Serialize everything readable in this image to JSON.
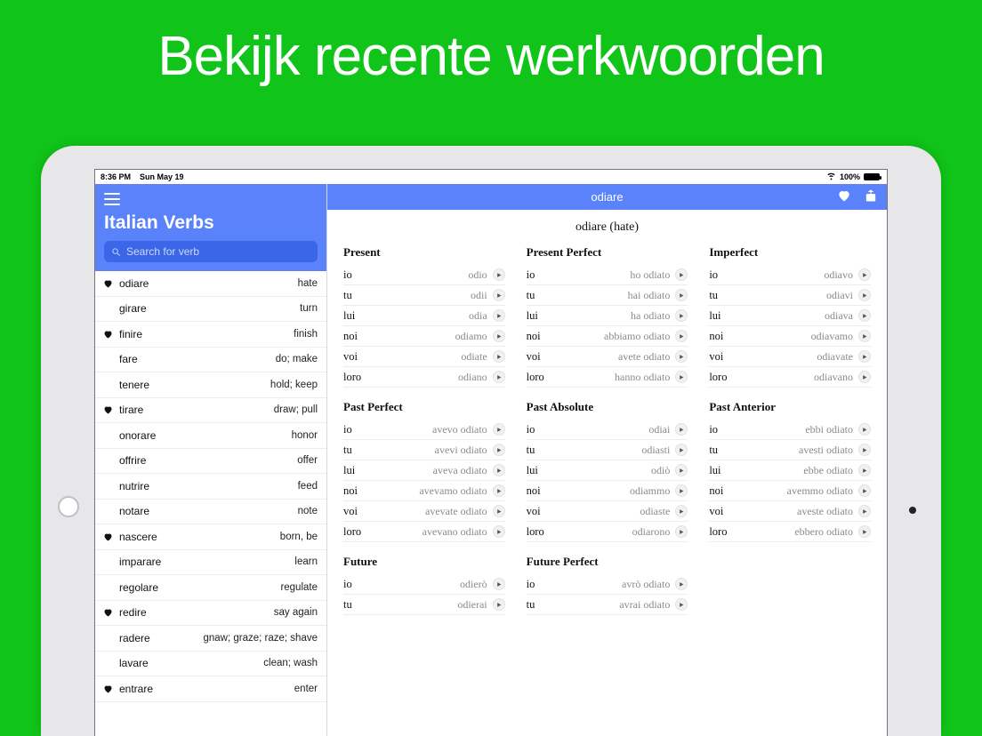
{
  "hero": "Bekijk recente werkwoorden",
  "status": {
    "time": "8:36 PM",
    "date": "Sun May 19",
    "battery": "100%"
  },
  "sidebar": {
    "title": "Italian Verbs",
    "search_placeholder": "Search for verb",
    "items": [
      {
        "fav": true,
        "verb": "odiare",
        "trans": "hate"
      },
      {
        "fav": false,
        "verb": "girare",
        "trans": "turn"
      },
      {
        "fav": true,
        "verb": "finire",
        "trans": "finish"
      },
      {
        "fav": false,
        "verb": "fare",
        "trans": "do; make"
      },
      {
        "fav": false,
        "verb": "tenere",
        "trans": "hold; keep"
      },
      {
        "fav": true,
        "verb": "tirare",
        "trans": "draw; pull"
      },
      {
        "fav": false,
        "verb": "onorare",
        "trans": "honor"
      },
      {
        "fav": false,
        "verb": "offrire",
        "trans": "offer"
      },
      {
        "fav": false,
        "verb": "nutrire",
        "trans": "feed"
      },
      {
        "fav": false,
        "verb": "notare",
        "trans": "note"
      },
      {
        "fav": true,
        "verb": "nascere",
        "trans": "born, be"
      },
      {
        "fav": false,
        "verb": "imparare",
        "trans": "learn"
      },
      {
        "fav": false,
        "verb": "regolare",
        "trans": "regulate"
      },
      {
        "fav": true,
        "verb": "redire",
        "trans": "say again"
      },
      {
        "fav": false,
        "verb": "radere",
        "trans": "gnaw; graze; raze; shave"
      },
      {
        "fav": false,
        "verb": "lavare",
        "trans": "clean; wash"
      },
      {
        "fav": true,
        "verb": "entrare",
        "trans": "enter"
      }
    ]
  },
  "detail": {
    "header": "odiare",
    "subtitle": "odiare (hate)",
    "pronouns": [
      "io",
      "tu",
      "lui",
      "noi",
      "voi",
      "loro"
    ],
    "tenses": [
      {
        "title": "Present",
        "forms": [
          "odio",
          "odii",
          "odia",
          "odiamo",
          "odiate",
          "odiano"
        ]
      },
      {
        "title": "Present Perfect",
        "forms": [
          "ho odiato",
          "hai odiato",
          "ha odiato",
          "abbiamo odiato",
          "avete odiato",
          "hanno odiato"
        ]
      },
      {
        "title": "Imperfect",
        "forms": [
          "odiavo",
          "odiavi",
          "odiava",
          "odiavamo",
          "odiavate",
          "odiavano"
        ]
      },
      {
        "title": "Past Perfect",
        "forms": [
          "avevo odiato",
          "avevi odiato",
          "aveva odiato",
          "avevamo odiato",
          "avevate odiato",
          "avevano odiato"
        ]
      },
      {
        "title": "Past Absolute",
        "forms": [
          "odiai",
          "odiasti",
          "odiò",
          "odiammo",
          "odiaste",
          "odiarono"
        ]
      },
      {
        "title": "Past Anterior",
        "forms": [
          "ebbi odiato",
          "avesti odiato",
          "ebbe odiato",
          "avemmo odiato",
          "aveste odiato",
          "ebbero odiato"
        ]
      },
      {
        "title": "Future",
        "forms": [
          "odierò",
          "odierai"
        ]
      },
      {
        "title": "Future Perfect",
        "forms": [
          "avrò odiato",
          "avrai odiato"
        ]
      }
    ]
  }
}
